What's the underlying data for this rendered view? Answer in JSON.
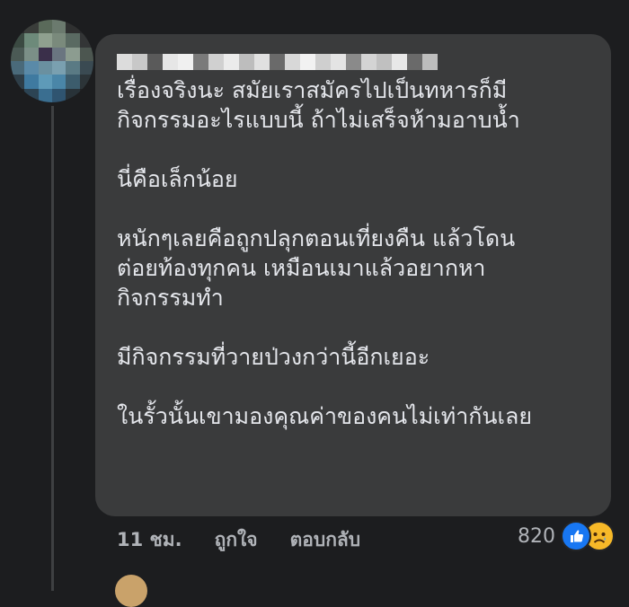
{
  "comment": {
    "author_blurred": true,
    "paragraphs": [
      "เรื่องจริงนะ สมัยเราสมัครไปเป็นทหารก็มี\nกิจกรรมอะไรแบบนี้ ถ้าไม่เสร็จห้ามอาบน้ำ",
      "นี่คือเล็กน้อย",
      "หนักๆเลยคือถูกปลุกตอนเที่ยงคืน แล้วโดน\nต่อยท้องทุกคน เหมือนเมาแล้วอยากหา\nกิจกรรมทำ",
      "มีกิจกรรมที่วายป่วงกว่านี้อีกเยอะ",
      "ในรั้วนั้นเขามองคุณค่าของคนไม่เท่ากันเลย"
    ]
  },
  "actions": {
    "time": "11 ชม.",
    "like_label": "ถูกใจ",
    "reply_label": "ตอบกลับ"
  },
  "reactions": {
    "count": "820",
    "icons": [
      "like-icon",
      "sad-icon"
    ]
  },
  "colors": {
    "background": "#1c1d1f",
    "bubble": "#3a3b3c",
    "text": "#e4e6eb",
    "muted": "#b0b3b8",
    "like_blue": "#1877f2",
    "sad_yellow": "#f7b928"
  }
}
